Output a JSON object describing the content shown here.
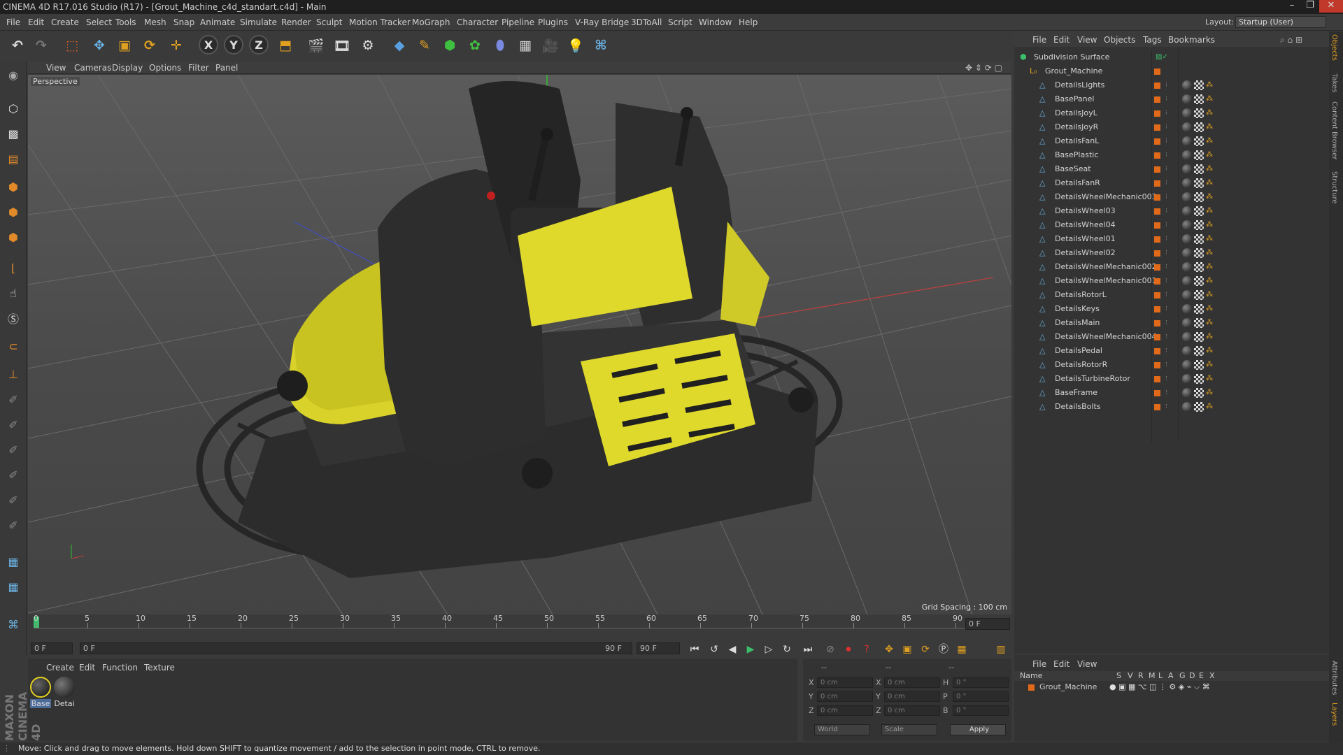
{
  "window": {
    "title": "CINEMA 4D R17.016 Studio (R17) - [Grout_Machine_c4d_standart.c4d] - Main"
  },
  "menu": [
    "File",
    "Edit",
    "Create",
    "Select",
    "Tools",
    "Mesh",
    "Snap",
    "Animate",
    "Simulate",
    "Render",
    "Sculpt",
    "Motion Tracker",
    "MoGraph",
    "Character",
    "Pipeline",
    "Plugins",
    "V-Ray Bridge",
    "3DToAll",
    "Script",
    "Window",
    "Help"
  ],
  "layout": {
    "label": "Layout:",
    "value": "Startup (User)"
  },
  "toolbar": {
    "axis_x": "X",
    "axis_y": "Y",
    "axis_z": "Z"
  },
  "viewport": {
    "menu": [
      "View",
      "Cameras",
      "Display",
      "Options",
      "Filter",
      "Panel"
    ],
    "camera": "Perspective",
    "grid_spacing": "Grid Spacing : 100 cm"
  },
  "timeline": {
    "ticks": [
      "0",
      "5",
      "10",
      "15",
      "20",
      "25",
      "30",
      "35",
      "40",
      "45",
      "50",
      "55",
      "60",
      "65",
      "70",
      "75",
      "80",
      "85",
      "90"
    ],
    "frame_end_field": "0 F",
    "start": "0 F",
    "range_start": "0 F",
    "range_end": "90 F",
    "end": "90 F"
  },
  "materials": {
    "menu": [
      "Create",
      "Edit",
      "Function",
      "Texture"
    ],
    "items": [
      {
        "label": "Base",
        "color": "#e0d020"
      },
      {
        "label": "Detai",
        "color": "#222222"
      }
    ]
  },
  "coords": {
    "header": [
      "--",
      "--",
      "--"
    ],
    "rows": [
      {
        "a": "X",
        "av": "0 cm",
        "b": "X",
        "bv": "0 cm",
        "c": "H",
        "cv": "0 °"
      },
      {
        "a": "Y",
        "av": "0 cm",
        "b": "Y",
        "bv": "0 cm",
        "c": "P",
        "cv": "0 °"
      },
      {
        "a": "Z",
        "av": "0 cm",
        "b": "Z",
        "bv": "0 cm",
        "c": "B",
        "cv": "0 °"
      }
    ],
    "world": "World",
    "scale": "Scale",
    "apply": "Apply"
  },
  "objects": {
    "menu": [
      "File",
      "Edit",
      "View",
      "Objects",
      "Tags",
      "Bookmarks"
    ],
    "root": "Subdivision Surface",
    "group": "Grout_Machine",
    "items": [
      "DetailsLights",
      "BasePanel",
      "DetailsJoyL",
      "DetailsJoyR",
      "DetailsFanL",
      "BasePlastic",
      "BaseSeat",
      "DetailsFanR",
      "DetailsWheelMechanic003",
      "DetailsWheel03",
      "DetailsWheel04",
      "DetailsWheel01",
      "DetailsWheel02",
      "DetailsWheelMechanic002",
      "DetailsWheelMechanic001",
      "DetailsRotorL",
      "DetailsKeys",
      "DetailsMain",
      "DetailsWheelMechanic004",
      "DetailsPedal",
      "DetailsRotorR",
      "DetailsTurbineRotor",
      "BaseFrame",
      "DetailsBolts"
    ]
  },
  "layers": {
    "menu": [
      "File",
      "Edit",
      "View"
    ],
    "columns": [
      "Name",
      "S",
      "V",
      "R",
      "M",
      "L",
      "A",
      "G",
      "D",
      "E",
      "X"
    ],
    "row": "Grout_Machine"
  },
  "right_tabs": [
    "Objects",
    "Takes",
    "Content Browser",
    "Structure",
    "Attributes",
    "Layers"
  ],
  "status": "Move: Click and drag to move elements. Hold down SHIFT to quantize movement / add to the selection in point mode, CTRL to remove.",
  "brand": "MAXON CINEMA 4D"
}
